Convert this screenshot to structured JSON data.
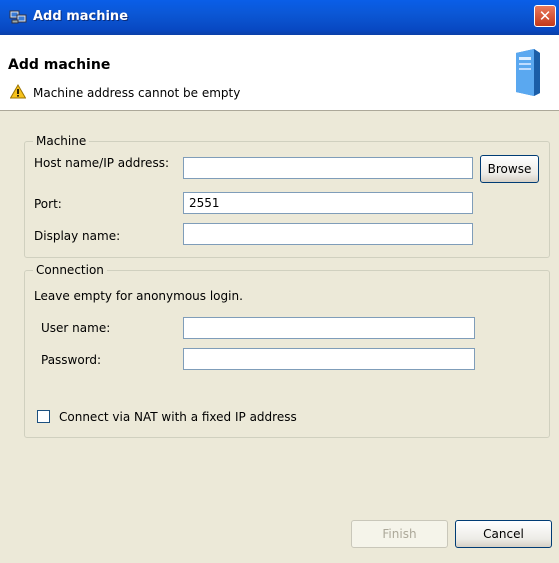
{
  "window": {
    "title": "Add machine",
    "close_glyph": "✕"
  },
  "header": {
    "title": "Add machine",
    "message": "Machine address cannot be empty",
    "message_icon": "warning-icon",
    "image_icon": "server-icon"
  },
  "machine_group": {
    "label": "Machine",
    "host_label": "Host name/IP address:",
    "host_value": "",
    "browse_label": "Browse",
    "port_label": "Port:",
    "port_value": "2551",
    "display_label": "Display name:",
    "display_value": ""
  },
  "connection_group": {
    "label": "Connection",
    "note": "Leave empty for anonymous login.",
    "user_label": "User name:",
    "user_value": "",
    "password_label": "Password:",
    "password_value": "",
    "nat_label": "Connect via NAT with a fixed IP address",
    "nat_checked": false
  },
  "footer": {
    "finish_label": "Finish",
    "cancel_label": "Cancel"
  },
  "colors": {
    "titlebar": "#0b57d5",
    "dialog_bg": "#ece9d8",
    "header_bg": "#ffffff",
    "input_border": "#7f9db9"
  }
}
